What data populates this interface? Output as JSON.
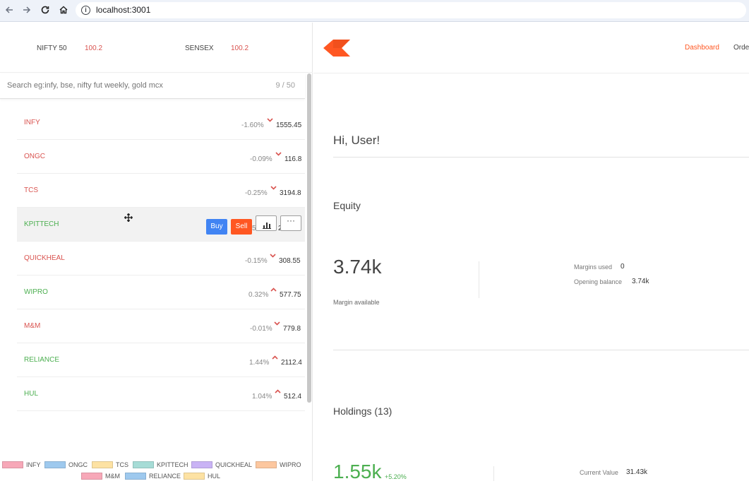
{
  "browser": {
    "url": "localhost:3001",
    "back_icon": "back-arrow-icon",
    "forward_icon": "forward-arrow-icon",
    "reload_icon": "reload-icon",
    "home_icon": "home-icon"
  },
  "indices": [
    {
      "name": "NIFTY 50",
      "value": "100.2"
    },
    {
      "name": "SENSEX",
      "value": "100.2"
    }
  ],
  "search": {
    "placeholder": "Search eg:infy, bse, nifty fut weekly, gold mcx",
    "count": "9 / 50"
  },
  "watchlist": [
    {
      "name": "INFY",
      "pct": "-1.60%",
      "price": "1555.45",
      "direction": "down"
    },
    {
      "name": "ONGC",
      "pct": "-0.09%",
      "price": "116.8",
      "direction": "down"
    },
    {
      "name": "TCS",
      "pct": "-0.25%",
      "price": "3194.8",
      "direction": "down"
    },
    {
      "name": "KPITTECH",
      "pct": "",
      "price": "",
      "direction": "up"
    },
    {
      "name": "QUICKHEAL",
      "pct": "-0.15%",
      "price": "308.55",
      "direction": "down"
    },
    {
      "name": "WIPRO",
      "pct": "0.32%",
      "price": "577.75",
      "direction": "up"
    },
    {
      "name": "M&M",
      "pct": "-0.01%",
      "price": "779.8",
      "direction": "down"
    },
    {
      "name": "RELIANCE",
      "pct": "1.44%",
      "price": "2112.4",
      "direction": "up"
    },
    {
      "name": "HUL",
      "pct": "1.04%",
      "price": "512.4",
      "direction": "up"
    }
  ],
  "hover_actions": {
    "buy_label": "Buy",
    "sell_label": "Sell",
    "more_label": "···"
  },
  "legend": [
    {
      "label": "INFY",
      "color": "#f7a8b8"
    },
    {
      "label": "ONGC",
      "color": "#9ec9ee"
    },
    {
      "label": "TCS",
      "color": "#fde2a3"
    },
    {
      "label": "KPITTECH",
      "color": "#a6dcd6"
    },
    {
      "label": "QUICKHEAL",
      "color": "#c9b3f5"
    },
    {
      "label": "WIPRO",
      "color": "#fcc79f"
    },
    {
      "label": "M&M",
      "color": "#f7a8b8"
    },
    {
      "label": "RELIANCE",
      "color": "#9ec9ee"
    },
    {
      "label": "HUL",
      "color": "#fde2a3"
    }
  ],
  "topnav": {
    "dashboard": "Dashboard",
    "orders": "Orde"
  },
  "dashboard": {
    "greeting": "Hi, User!",
    "equity_title": "Equity",
    "margin_available_value": "3.74k",
    "margin_available_label": "Margin available",
    "margins_used_label": "Margins used",
    "margins_used_value": "0",
    "opening_balance_label": "Opening balance",
    "opening_balance_value": "3.74k",
    "holdings_title": "Holdings (13)",
    "holdings_value": "1.55k",
    "holdings_pct": "+5.20%",
    "current_value_label": "Current Value",
    "current_value_value": "31.43k"
  },
  "colors": {
    "accent": "#ff5722",
    "buy": "#4184f3",
    "down": "#d9534f",
    "up": "#4caf50",
    "nav_active": "#ff5722"
  }
}
